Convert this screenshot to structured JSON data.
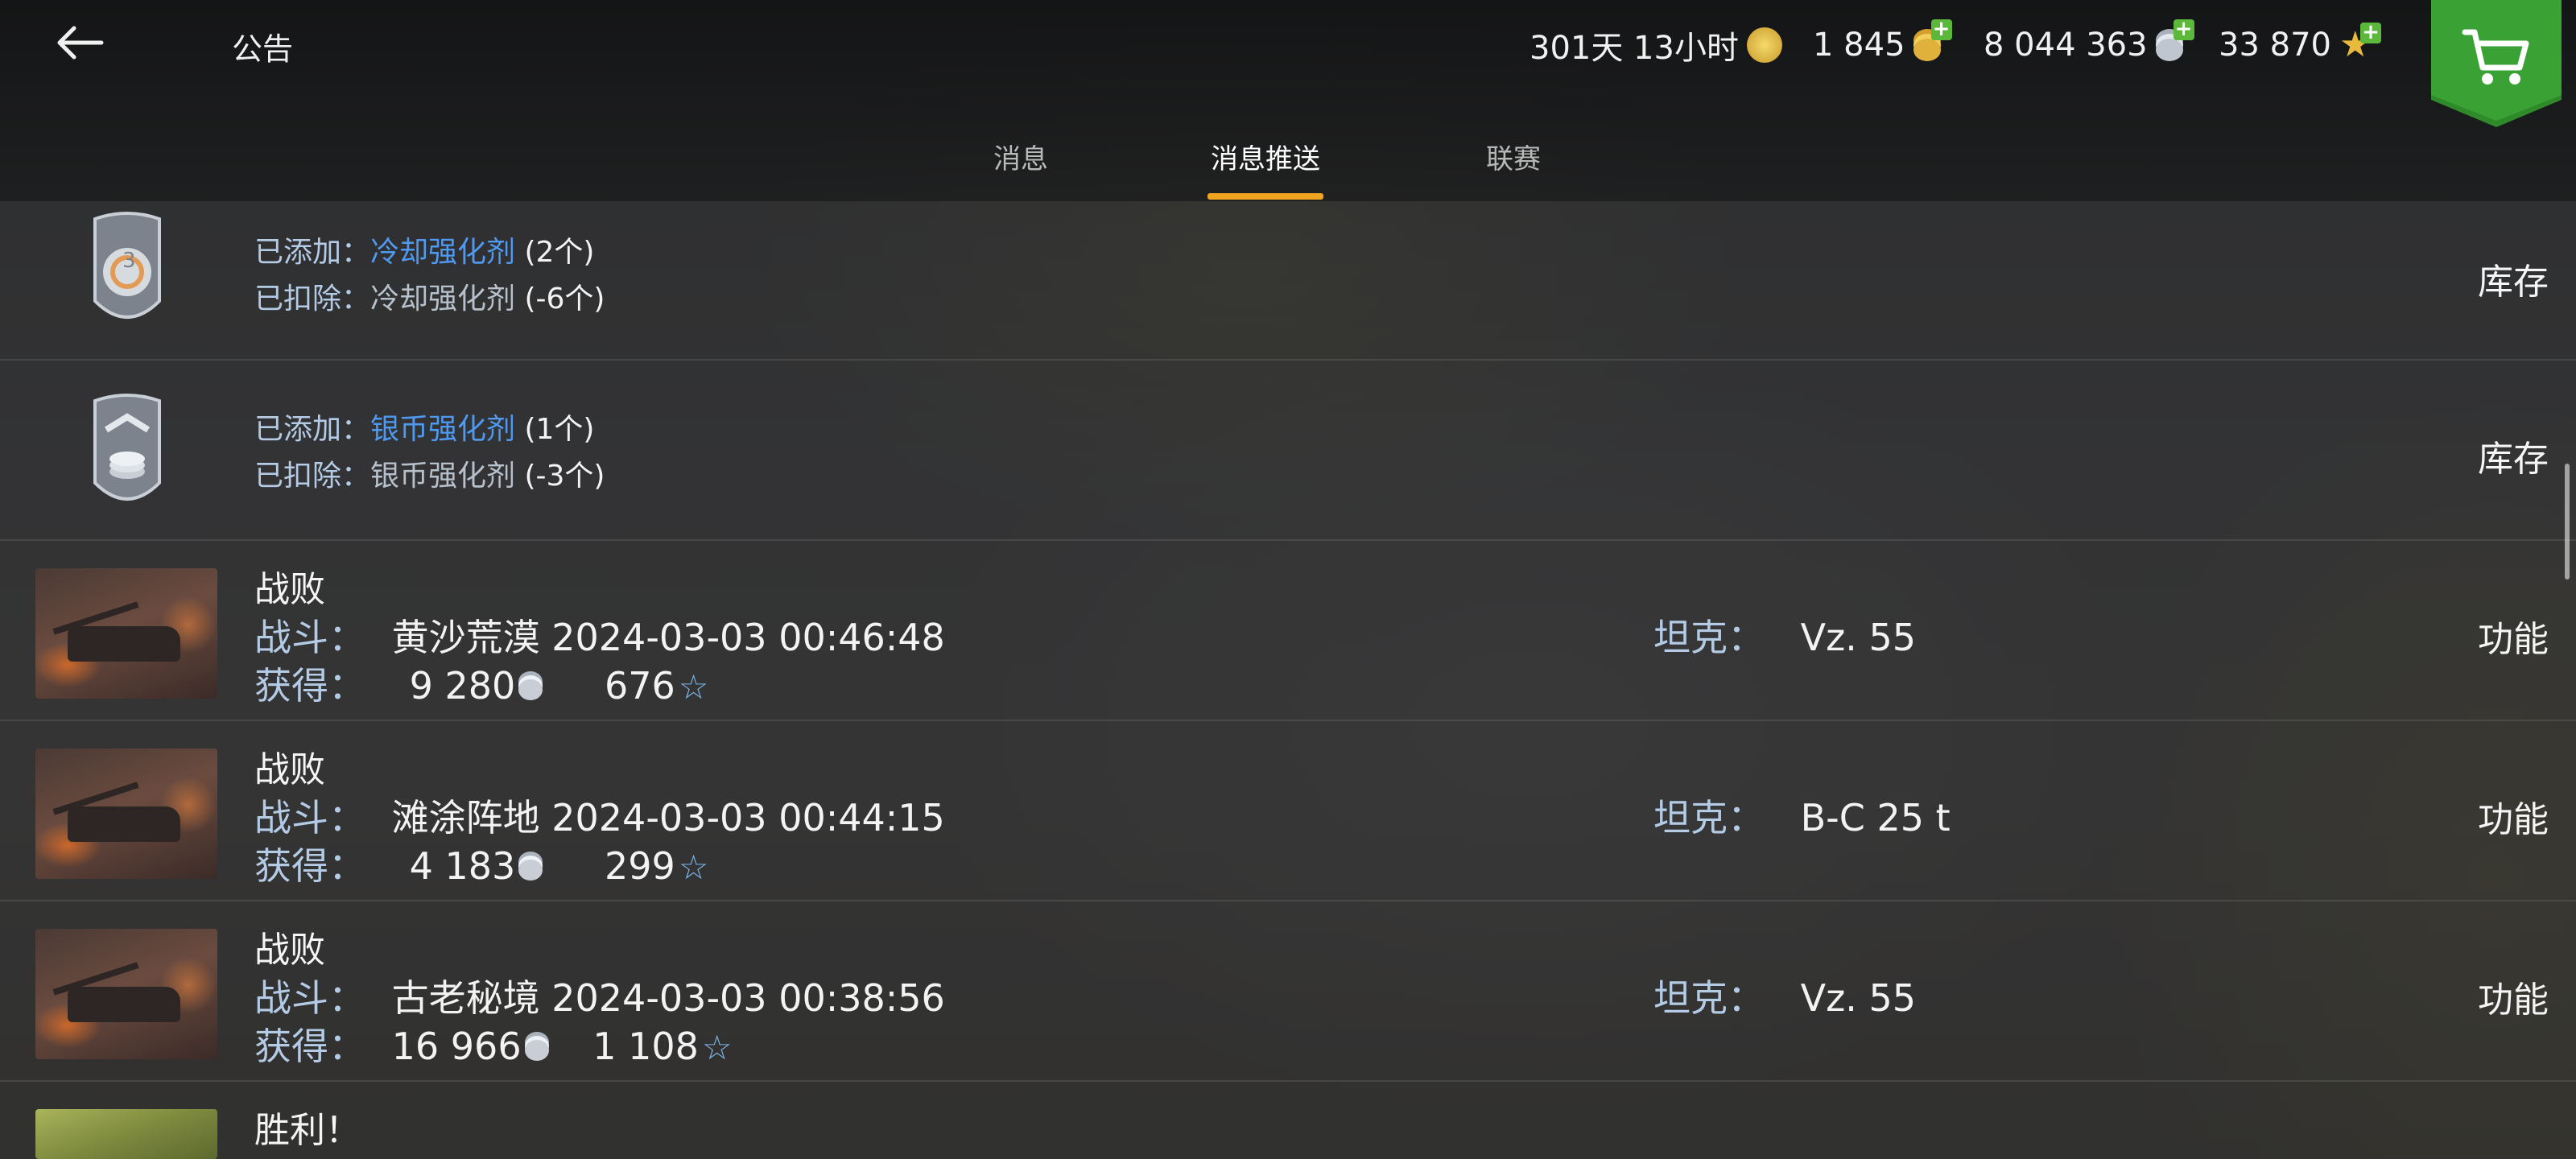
{
  "header": {
    "title": "公告",
    "premium_time": "301天 13小时",
    "gold": "1 845",
    "silver": "8 044 363",
    "free_xp": "33 870"
  },
  "tabs": [
    {
      "label": "消息",
      "active": false
    },
    {
      "label": "消息推送",
      "active": true
    },
    {
      "label": "联赛",
      "active": false
    }
  ],
  "colors": {
    "accent": "#f0a41f",
    "link": "#4f9af0",
    "shop": "#2f8a2a"
  },
  "items": [
    {
      "type": "booster",
      "icon": "cooling-booster-icon",
      "added_label": "已添加：",
      "added_name": "冷却强化剂",
      "added_count": "(2个)",
      "removed_label": "已扣除：",
      "removed_name": "冷却强化剂",
      "removed_count": "(-6个)",
      "action": "库存"
    },
    {
      "type": "booster",
      "icon": "silver-booster-icon",
      "added_label": "已添加：",
      "added_name": "银币强化剂",
      "added_count": "(1个)",
      "removed_label": "已扣除：",
      "removed_name": "银币强化剂",
      "removed_count": "(-3个)",
      "action": "库存"
    },
    {
      "type": "battle",
      "result": "战败",
      "battle_label": "战斗：",
      "battle_info": "黄沙荒漠 2024-03-03 00:46:48",
      "earn_label": "获得：",
      "silver": "9 280",
      "xp": "676",
      "tank_label": "坦克：",
      "tank": "Vz. 55",
      "action": "功能"
    },
    {
      "type": "battle",
      "result": "战败",
      "battle_label": "战斗：",
      "battle_info": "滩涂阵地 2024-03-03 00:44:15",
      "earn_label": "获得：",
      "silver": "4 183",
      "xp": "299",
      "tank_label": "坦克：",
      "tank": "B-C 25 t",
      "action": "功能"
    },
    {
      "type": "battle",
      "result": "战败",
      "battle_label": "战斗：",
      "battle_info": "古老秘境 2024-03-03 00:38:56",
      "earn_label": "获得：",
      "silver": "16 966",
      "xp": "1 108",
      "tank_label": "坦克：",
      "tank": "Vz. 55",
      "action": "功能"
    },
    {
      "type": "battle",
      "result": "胜利！"
    }
  ]
}
